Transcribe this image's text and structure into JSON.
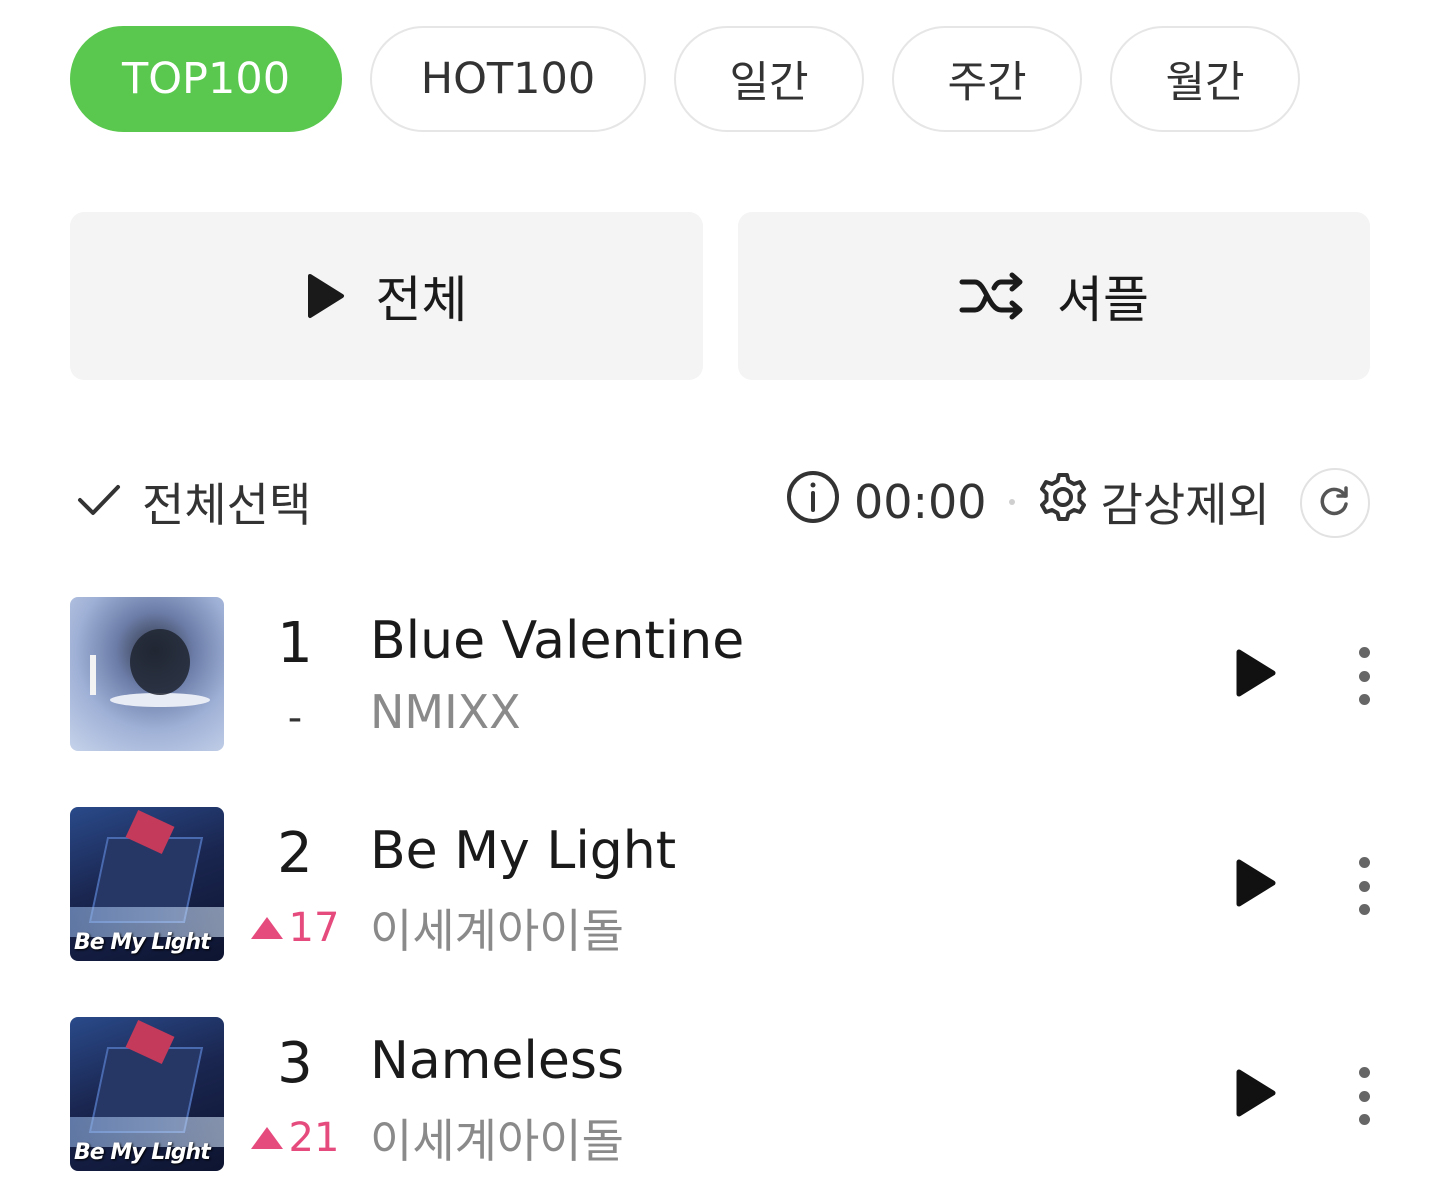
{
  "tabs": [
    {
      "label": "TOP100",
      "active": true
    },
    {
      "label": "HOT100",
      "active": false
    },
    {
      "label": "일간",
      "active": false
    },
    {
      "label": "주간",
      "active": false
    },
    {
      "label": "월간",
      "active": false
    }
  ],
  "actions": {
    "play_all_label": "전체",
    "shuffle_label": "셔플"
  },
  "toolbar": {
    "select_all_label": "전체선택",
    "timer_value": "00:00",
    "exclude_label": "감상제외"
  },
  "colors": {
    "accent": "#5ac84e",
    "rank_up": "#e64b7e"
  },
  "chart": [
    {
      "rank": "1",
      "change": "-",
      "change_direction": "none",
      "title": "Blue Valentine",
      "artist": "NMIXX",
      "cover_text": ""
    },
    {
      "rank": "2",
      "change": "17",
      "change_direction": "up",
      "title": "Be My Light",
      "artist": "이세계아이돌",
      "cover_text": "Be My Light"
    },
    {
      "rank": "3",
      "change": "21",
      "change_direction": "up",
      "title": "Nameless",
      "artist": "이세계아이돌",
      "cover_text": "Be My Light"
    }
  ]
}
